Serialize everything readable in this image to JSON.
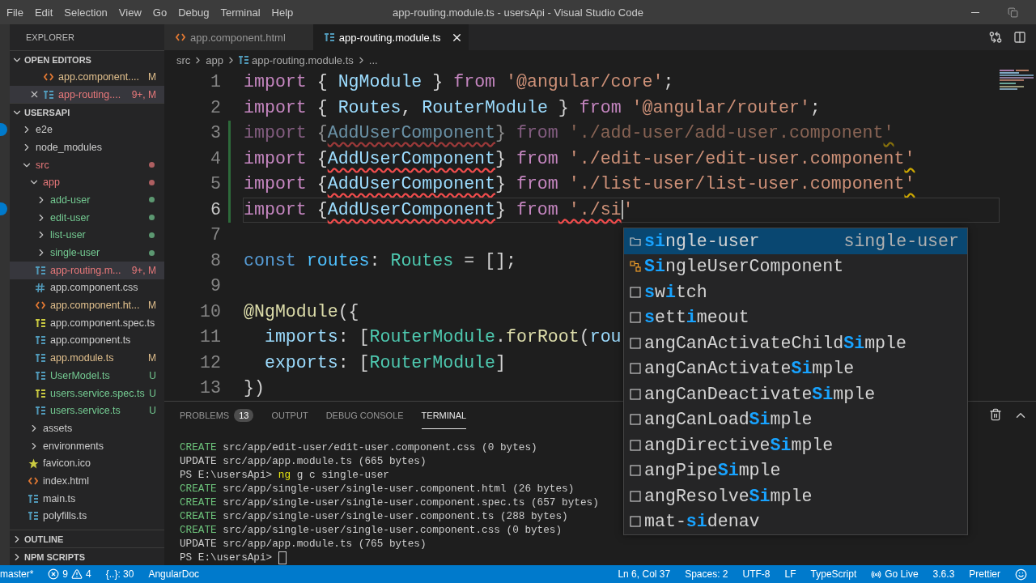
{
  "title_bar": {
    "menu": [
      "File",
      "Edit",
      "Selection",
      "View",
      "Go",
      "Debug",
      "Terminal",
      "Help"
    ],
    "title": "app-routing.module.ts - usersApi - Visual Studio Code"
  },
  "sidebar": {
    "title": "EXPLORER",
    "open_editors": {
      "title": "OPEN EDITORS",
      "expanded": true,
      "items": [
        {
          "kind": "html",
          "name": "app.component....",
          "badge": "M",
          "color": "#e2c08d",
          "selected": false
        },
        {
          "kind": "ts",
          "name": "app-routing....",
          "badge": "9+, M",
          "color": "#e8787a",
          "selected": true
        }
      ]
    },
    "project": {
      "title": "USERSAPI",
      "expanded": true,
      "tree": [
        {
          "kind": "folder",
          "name": "e2e",
          "expanded": false,
          "selected": false,
          "color": "#cccccc"
        },
        {
          "kind": "folder",
          "name": "node_modules",
          "expanded": false,
          "selected": false,
          "color": "#cccccc"
        },
        {
          "kind": "folder",
          "name": "src",
          "expanded": true,
          "selected": false,
          "color": "#e8787a",
          "dot": true,
          "children": [
            {
              "kind": "folder",
              "name": "app",
              "expanded": true,
              "selected": false,
              "color": "#e8787a",
              "dot": true,
              "children": [
                {
                  "kind": "folder",
                  "name": "add-user",
                  "expanded": false,
                  "selected": false,
                  "color": "#73c991",
                  "dot": true
                },
                {
                  "kind": "folder",
                  "name": "edit-user",
                  "expanded": false,
                  "selected": false,
                  "color": "#73c991",
                  "dot": true
                },
                {
                  "kind": "folder",
                  "name": "list-user",
                  "expanded": false,
                  "selected": false,
                  "color": "#73c991",
                  "dot": true
                },
                {
                  "kind": "folder",
                  "name": "single-user",
                  "expanded": false,
                  "selected": false,
                  "color": "#73c991",
                  "dot": true
                },
                {
                  "kind": "ts",
                  "name": "app-routing.m...",
                  "badge": "9+, M",
                  "selected": true,
                  "color": "#e8787a"
                },
                {
                  "kind": "css",
                  "name": "app.component.css",
                  "selected": false,
                  "color": "#cccccc"
                },
                {
                  "kind": "html",
                  "name": "app.component.ht...",
                  "badge": "M",
                  "selected": false,
                  "color": "#e2c08d"
                },
                {
                  "kind": "test",
                  "name": "app.component.spec.ts",
                  "selected": false,
                  "color": "#cccccc"
                },
                {
                  "kind": "ts",
                  "name": "app.component.ts",
                  "selected": false,
                  "color": "#cccccc"
                },
                {
                  "kind": "ts",
                  "name": "app.module.ts",
                  "badge": "M",
                  "selected": false,
                  "color": "#e2c08d"
                },
                {
                  "kind": "ts",
                  "name": "UserModel.ts",
                  "badge": "U",
                  "selected": false,
                  "color": "#73c991"
                },
                {
                  "kind": "test",
                  "name": "users.service.spec.ts",
                  "badge": "U",
                  "selected": false,
                  "color": "#73c991"
                },
                {
                  "kind": "ts",
                  "name": "users.service.ts",
                  "badge": "U",
                  "selected": false,
                  "color": "#73c991"
                }
              ]
            },
            {
              "kind": "folder",
              "name": "assets",
              "expanded": false,
              "selected": false,
              "color": "#cccccc"
            },
            {
              "kind": "folder",
              "name": "environments",
              "expanded": false,
              "selected": false,
              "color": "#cccccc"
            },
            {
              "kind": "star",
              "name": "favicon.ico",
              "selected": false,
              "color": "#cccccc"
            },
            {
              "kind": "html",
              "name": "index.html",
              "selected": false,
              "color": "#cccccc"
            },
            {
              "kind": "ts",
              "name": "main.ts",
              "selected": false,
              "color": "#cccccc"
            },
            {
              "kind": "ts",
              "name": "polyfills.ts",
              "selected": false,
              "color": "#cccccc"
            }
          ]
        }
      ]
    },
    "sections": [
      {
        "title": "OUTLINE",
        "expanded": false
      },
      {
        "title": "NPM SCRIPTS",
        "expanded": false
      }
    ]
  },
  "tabs": [
    {
      "kind": "html",
      "label": "app.component.html",
      "selected": false
    },
    {
      "kind": "ts",
      "label": "app-routing.module.ts",
      "selected": true
    }
  ],
  "breadcrumb": [
    {
      "label": "src"
    },
    {
      "label": "app"
    },
    {
      "label": "app-routing.module.ts",
      "kind": "ts"
    },
    {
      "label": "..."
    }
  ],
  "code_lines": [
    {
      "number": "1",
      "tokens": [
        {
          "t": "import",
          "kind": "keyword"
        },
        {
          "t": " { ",
          "kind": "plain"
        },
        {
          "t": "NgModule",
          "kind": "variable"
        },
        {
          "t": " } ",
          "kind": "plain"
        },
        {
          "t": "from",
          "kind": "keyword"
        },
        {
          "t": " '@angular/core'",
          "kind": "string"
        },
        {
          "t": ";",
          "kind": "plain"
        }
      ]
    },
    {
      "number": "2",
      "tokens": [
        {
          "t": "import",
          "kind": "keyword"
        },
        {
          "t": " { ",
          "kind": "plain"
        },
        {
          "t": "Routes",
          "kind": "variable"
        },
        {
          "t": ", ",
          "kind": "plain"
        },
        {
          "t": "RouterModule",
          "kind": "variable"
        },
        {
          "t": " } ",
          "kind": "plain"
        },
        {
          "t": "from",
          "kind": "keyword"
        },
        {
          "t": " '@angular/router'",
          "kind": "string"
        },
        {
          "t": ";",
          "kind": "plain"
        }
      ]
    },
    {
      "number": "3",
      "faded": true,
      "changed": true,
      "tokens": [
        {
          "t": "import",
          "kind": "keyword"
        },
        {
          "t": " {",
          "kind": "plain"
        },
        {
          "t": "AddUserComponent",
          "kind": "variable",
          "error": true
        },
        {
          "t": "} ",
          "kind": "plain"
        },
        {
          "t": "from",
          "kind": "keyword"
        },
        {
          "t": " './add-user/add-user.component",
          "kind": "string"
        },
        {
          "t": "'",
          "kind": "string",
          "warning": true
        }
      ]
    },
    {
      "number": "4",
      "changed": true,
      "tokens": [
        {
          "t": "import",
          "kind": "keyword"
        },
        {
          "t": " {",
          "kind": "plain"
        },
        {
          "t": "AddUserComponent",
          "kind": "variable",
          "error": true
        },
        {
          "t": "} ",
          "kind": "plain"
        },
        {
          "t": "from",
          "kind": "keyword"
        },
        {
          "t": " './edit-user/edit-user.component",
          "kind": "string"
        },
        {
          "t": "'",
          "kind": "string",
          "warning": true
        }
      ]
    },
    {
      "number": "5",
      "changed": true,
      "tokens": [
        {
          "t": "import",
          "kind": "keyword"
        },
        {
          "t": " {",
          "kind": "plain"
        },
        {
          "t": "AddUserComponent",
          "kind": "variable",
          "error": true
        },
        {
          "t": "} ",
          "kind": "plain"
        },
        {
          "t": "from",
          "kind": "keyword"
        },
        {
          "t": " './list-user/list-user.component",
          "kind": "string"
        },
        {
          "t": "'",
          "kind": "string",
          "warning": true
        }
      ]
    },
    {
      "number": "6",
      "current": true,
      "changed": true,
      "tokens": [
        {
          "t": "import",
          "kind": "keyword"
        },
        {
          "t": " {",
          "kind": "plain"
        },
        {
          "t": "AddUserComponent",
          "kind": "variable",
          "error": true
        },
        {
          "t": "} ",
          "kind": "plain"
        },
        {
          "t": "from",
          "kind": "keyword"
        },
        {
          "t": " './si",
          "kind": "string",
          "error": true,
          "cursor": true
        },
        {
          "t": "'",
          "kind": "string"
        }
      ]
    },
    {
      "number": "7"
    },
    {
      "number": "8",
      "tokens": [
        {
          "t": "const",
          "kind": "declaration"
        },
        {
          "t": " routes",
          "kind": "constant"
        },
        {
          "t": ": ",
          "kind": "plain"
        },
        {
          "t": "Routes",
          "kind": "type"
        },
        {
          "t": " = [];",
          "kind": "plain"
        }
      ]
    },
    {
      "number": "9"
    },
    {
      "number": "10",
      "tokens": [
        {
          "t": "@NgModule",
          "kind": "function"
        },
        {
          "t": "({",
          "kind": "plain"
        }
      ]
    },
    {
      "number": "11",
      "tokens": [
        {
          "t": "  imports",
          "kind": "variable"
        },
        {
          "t": ": [",
          "kind": "plain"
        },
        {
          "t": "RouterModule",
          "kind": "type"
        },
        {
          "t": ".",
          "kind": "plain"
        },
        {
          "t": "forRoot",
          "kind": "function"
        },
        {
          "t": "(",
          "kind": "plain"
        },
        {
          "t": "rou",
          "kind": "variable"
        }
      ]
    },
    {
      "number": "12",
      "tokens": [
        {
          "t": "  exports",
          "kind": "variable"
        },
        {
          "t": ": [",
          "kind": "plain"
        },
        {
          "t": "RouterModule",
          "kind": "type"
        },
        {
          "t": "]",
          "kind": "plain"
        }
      ]
    },
    {
      "number": "13",
      "tokens": [
        {
          "t": "})",
          "kind": "plain"
        }
      ]
    }
  ],
  "suggestions": [
    {
      "kind": "folder",
      "selected": true,
      "parts": [
        {
          "t": "si",
          "match": true
        },
        {
          "t": "ngle-user",
          "match": false
        }
      ],
      "detail": "single-user"
    },
    {
      "kind": "class",
      "selected": false,
      "parts": [
        {
          "t": "Si",
          "match": true
        },
        {
          "t": "ngleUserComponent",
          "match": false
        }
      ]
    },
    {
      "kind": "snippet",
      "selected": false,
      "parts": [
        {
          "t": "s",
          "match": true
        },
        {
          "t": "w",
          "match": false
        },
        {
          "t": "i",
          "match": true
        },
        {
          "t": "tch",
          "match": false
        }
      ]
    },
    {
      "kind": "snippet",
      "selected": false,
      "parts": [
        {
          "t": "s",
          "match": true
        },
        {
          "t": "ett",
          "match": false
        },
        {
          "t": "i",
          "match": true
        },
        {
          "t": "meout",
          "match": false
        }
      ]
    },
    {
      "kind": "snippet",
      "selected": false,
      "parts": [
        {
          "t": "angCanActivateChild",
          "match": false
        },
        {
          "t": "Si",
          "match": true
        },
        {
          "t": "mple",
          "match": false
        }
      ]
    },
    {
      "kind": "snippet",
      "selected": false,
      "parts": [
        {
          "t": "angCanActivate",
          "match": false
        },
        {
          "t": "Si",
          "match": true
        },
        {
          "t": "mple",
          "match": false
        }
      ]
    },
    {
      "kind": "snippet",
      "selected": false,
      "parts": [
        {
          "t": "angCanDeactivate",
          "match": false
        },
        {
          "t": "Si",
          "match": true
        },
        {
          "t": "mple",
          "match": false
        }
      ]
    },
    {
      "kind": "snippet",
      "selected": false,
      "parts": [
        {
          "t": "angCanLoad",
          "match": false
        },
        {
          "t": "Si",
          "match": true
        },
        {
          "t": "mple",
          "match": false
        }
      ]
    },
    {
      "kind": "snippet",
      "selected": false,
      "parts": [
        {
          "t": "angDirective",
          "match": false
        },
        {
          "t": "Si",
          "match": true
        },
        {
          "t": "mple",
          "match": false
        }
      ]
    },
    {
      "kind": "snippet",
      "selected": false,
      "parts": [
        {
          "t": "angPipe",
          "match": false
        },
        {
          "t": "Si",
          "match": true
        },
        {
          "t": "mple",
          "match": false
        }
      ]
    },
    {
      "kind": "snippet",
      "selected": false,
      "parts": [
        {
          "t": "angResolve",
          "match": false
        },
        {
          "t": "Si",
          "match": true
        },
        {
          "t": "mple",
          "match": false
        }
      ]
    },
    {
      "kind": "snippet",
      "selected": false,
      "parts": [
        {
          "t": "mat-",
          "match": false
        },
        {
          "t": "si",
          "match": true
        },
        {
          "t": "denav",
          "match": false
        }
      ]
    }
  ],
  "panel": {
    "tabs": [
      {
        "label": "PROBLEMS",
        "badge": "13",
        "selected": false
      },
      {
        "label": "OUTPUT",
        "selected": false
      },
      {
        "label": "DEBUG CONSOLE",
        "selected": false
      },
      {
        "label": "TERMINAL",
        "selected": true
      }
    ],
    "terminal": [
      {
        "kind": "create",
        "tag": "CREATE",
        "text": "src/app/edit-user/edit-user.component.css (0 bytes)"
      },
      {
        "kind": "update",
        "tag": "UPDATE",
        "text": "src/app/app.module.ts (665 bytes)"
      },
      {
        "kind": "prompt",
        "prompt": "PS E:\\usersApi>",
        "command": "ng",
        "args": "g c single-user"
      },
      {
        "kind": "create",
        "tag": "CREATE",
        "text": "src/app/single-user/single-user.component.html (26 bytes)"
      },
      {
        "kind": "create",
        "tag": "CREATE",
        "text": "src/app/single-user/single-user.component.spec.ts (657 bytes)"
      },
      {
        "kind": "create",
        "tag": "CREATE",
        "text": "src/app/single-user/single-user.component.ts (288 bytes)"
      },
      {
        "kind": "create",
        "tag": "CREATE",
        "text": "src/app/single-user/single-user.component.css (0 bytes)"
      },
      {
        "kind": "update",
        "tag": "UPDATE",
        "text": "src/app/app.module.ts (765 bytes)"
      },
      {
        "kind": "prompt",
        "prompt": "PS E:\\usersApi>",
        "cursor": true
      }
    ]
  },
  "status_bar": {
    "branch": "master*",
    "errors": "9",
    "warnings": "4",
    "symbols": "{..}: 30",
    "extension": "AngularDoc",
    "right": [
      {
        "kind": "text",
        "label": "Ln 6, Col 37"
      },
      {
        "kind": "text",
        "label": "Spaces: 2"
      },
      {
        "kind": "text",
        "label": "UTF-8"
      },
      {
        "kind": "text",
        "label": "LF"
      },
      {
        "kind": "text",
        "label": "TypeScript"
      },
      {
        "kind": "live",
        "label": "Go Live"
      },
      {
        "kind": "text",
        "label": "3.6.3"
      },
      {
        "kind": "text",
        "label": "Prettier"
      },
      {
        "kind": "feedback"
      }
    ]
  }
}
